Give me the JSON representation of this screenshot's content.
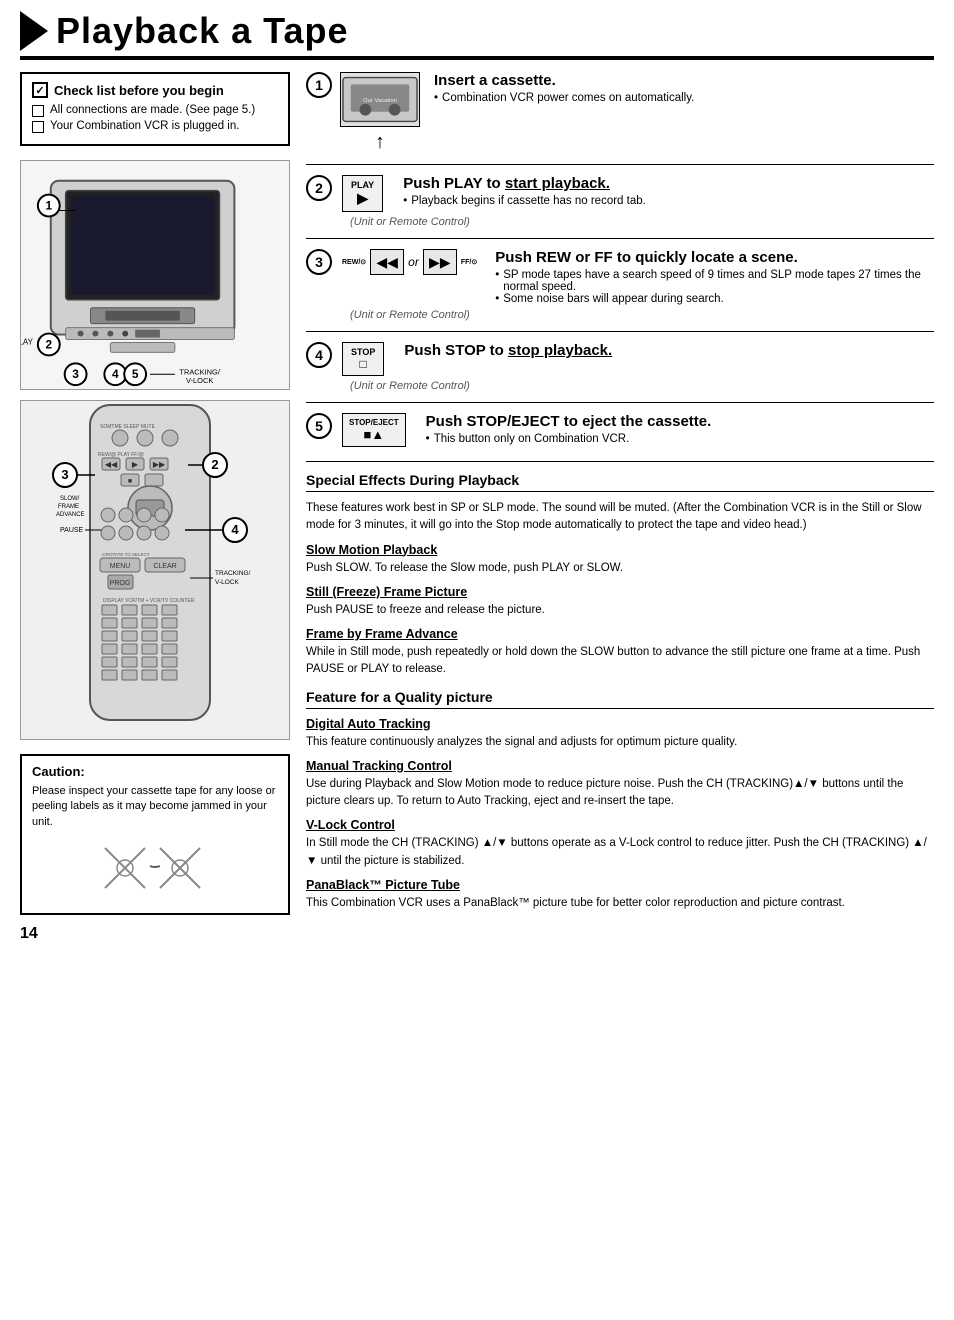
{
  "header": {
    "title": "Playback a Tape"
  },
  "left": {
    "checklist": {
      "title": "Check list before you begin",
      "items": [
        "All connections are made. (See page 5.)",
        "Your Combination VCR is plugged in."
      ]
    },
    "caution": {
      "title": "Caution:",
      "text": "Please inspect your cassette tape for any loose or peeling labels as it may become jammed in your unit."
    }
  },
  "right": {
    "steps": [
      {
        "number": "1",
        "title": "Insert a cassette.",
        "bullets": [
          "Combination VCR power comes on automatically."
        ],
        "unit_label": ""
      },
      {
        "number": "2",
        "button": "PLAY",
        "title": "Push PLAY to start playback.",
        "bullets": [
          "Playback begins if cassette has no record tab."
        ],
        "unit_label": "(Unit or Remote Control)"
      },
      {
        "number": "3",
        "button": "REW/FF",
        "title": "Push REW or FF to quickly locate a scene.",
        "bullets": [
          "SP mode tapes have a search speed of 9 times and SLP mode tapes 27 times the normal speed.",
          "Some noise bars will appear during search."
        ],
        "unit_label": "(Unit or Remote Control)"
      },
      {
        "number": "4",
        "button": "STOP",
        "title": "Push STOP to stop playback.",
        "bullets": [],
        "unit_label": "(Unit or Remote Control)"
      },
      {
        "number": "5",
        "button": "STOP/EJECT",
        "title": "Push STOP/EJECT to eject the cassette.",
        "bullets": [
          "This button only on Combination VCR."
        ],
        "unit_label": ""
      }
    ],
    "special_effects": {
      "section_title": "Special Effects During Playback",
      "intro": "These features work best in SP or SLP mode. The sound will be muted. (After the Combination VCR is in the Still or Slow mode for 3 minutes, it will go into the Stop mode automatically to protect the tape and video head.)",
      "items": [
        {
          "title": "Slow Motion Playback",
          "text": "Push SLOW. To release the Slow mode, push PLAY or SLOW."
        },
        {
          "title": "Still (Freeze) Frame Picture",
          "text": "Push PAUSE to freeze and release the picture."
        },
        {
          "title": "Frame by Frame Advance",
          "text": "While in Still mode, push repeatedly or hold down the SLOW button to advance the still picture one frame at a time. Push PAUSE or PLAY to release."
        }
      ]
    },
    "feature_section": {
      "section_title": "Feature for a Quality picture",
      "items": [
        {
          "title": "Digital Auto Tracking",
          "text": "This feature continuously analyzes the signal and adjusts for optimum picture quality."
        },
        {
          "title": "Manual Tracking Control",
          "text": "Use during Playback and Slow Motion mode to reduce picture noise. Push the CH (TRACKING)▲/▼ buttons until the picture clears up. To return to Auto Tracking, eject and re-insert the tape."
        },
        {
          "title": "V-Lock Control",
          "text": "In Still mode the CH (TRACKING) ▲/▼ buttons operate as a V-Lock control to reduce jitter. Push the CH (TRACKING) ▲/▼ until the picture is stabilized."
        },
        {
          "title": "PanaBlack™ Picture Tube",
          "text": "This Combination VCR uses a PanaBlack™ picture tube for better color reproduction and picture contrast."
        }
      ]
    }
  },
  "page_number": "14",
  "diagram_labels": {
    "vcr_labels": [
      "①",
      "②",
      "③",
      "④",
      "⑤"
    ],
    "remote_labels": [
      "②",
      "③",
      "④"
    ],
    "text_labels": {
      "play": "PLAY",
      "slow_frame_advance": "SLOW/ FRAME ADVANCE",
      "pause": "PAUSE",
      "tracking_vlock": "TRACKING/ V-LOCK"
    }
  }
}
